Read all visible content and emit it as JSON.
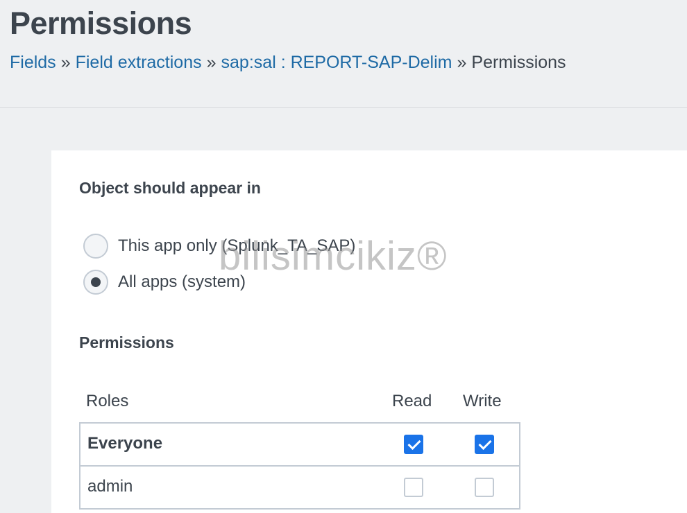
{
  "header": {
    "title": "Permissions",
    "breadcrumb": [
      {
        "label": "Fields"
      },
      {
        "label": "Field extractions"
      },
      {
        "label": "sap:sal : REPORT-SAP-Delim"
      }
    ],
    "separator": "»",
    "current": "Permissions"
  },
  "object_section": {
    "title": "Object should appear in",
    "options": [
      {
        "label": "This app only (Splunk_TA_SAP)",
        "checked": false
      },
      {
        "label": "All apps (system)",
        "checked": true
      }
    ]
  },
  "permissions_section": {
    "title": "Permissions",
    "columns": {
      "roles": "Roles",
      "read": "Read",
      "write": "Write"
    },
    "rows": [
      {
        "role": "Everyone",
        "read": true,
        "write": true
      },
      {
        "role": "admin",
        "read": false,
        "write": false
      }
    ]
  },
  "watermark": "bilisimcikiz®",
  "colors": {
    "link": "#1e6aa5",
    "checkbox_checked": "#1a73e8",
    "text": "#3c444d",
    "background": "#eef0f2"
  }
}
